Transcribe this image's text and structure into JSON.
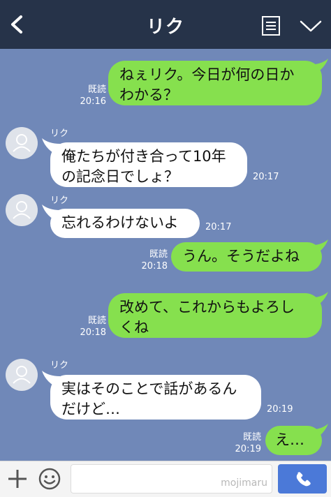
{
  "header": {
    "title": "リク",
    "back_icon": "chevron-left-icon",
    "menu_icon": "notes-icon",
    "expand_icon": "chevron-down-icon"
  },
  "messages": [
    {
      "from": "me",
      "lines": [
        "ねぇリク。今日が何の日か",
        "わかる？"
      ],
      "read": "既読",
      "time": "20:16"
    },
    {
      "from": "other",
      "sender": "リク",
      "lines": [
        "俺たちが付き合って10年",
        "の記念日でしょ？"
      ],
      "time": "20:17"
    },
    {
      "from": "other",
      "sender": "リク",
      "lines": [
        "忘れるわけないよ"
      ],
      "time": "20:17"
    },
    {
      "from": "me",
      "lines": [
        "うん。そうだよね"
      ],
      "read": "既読",
      "time": "20:18"
    },
    {
      "from": "me",
      "lines": [
        "改めて、これからもよろし",
        "くね"
      ],
      "read": "既読",
      "time": "20:18"
    },
    {
      "from": "other",
      "sender": "リク",
      "lines": [
        "実はそのことで話があるん",
        "だけど…"
      ],
      "time": "20:19"
    },
    {
      "from": "me",
      "lines": [
        "え…"
      ],
      "read": "既読",
      "time": "20:19"
    }
  ],
  "footer": {
    "watermark": "mojimaru",
    "send_icon": "phone-icon"
  },
  "colors": {
    "header": "#263349",
    "background": "#7088b8",
    "my_bubble": "#86e04e",
    "send_button": "#4b79d8"
  }
}
